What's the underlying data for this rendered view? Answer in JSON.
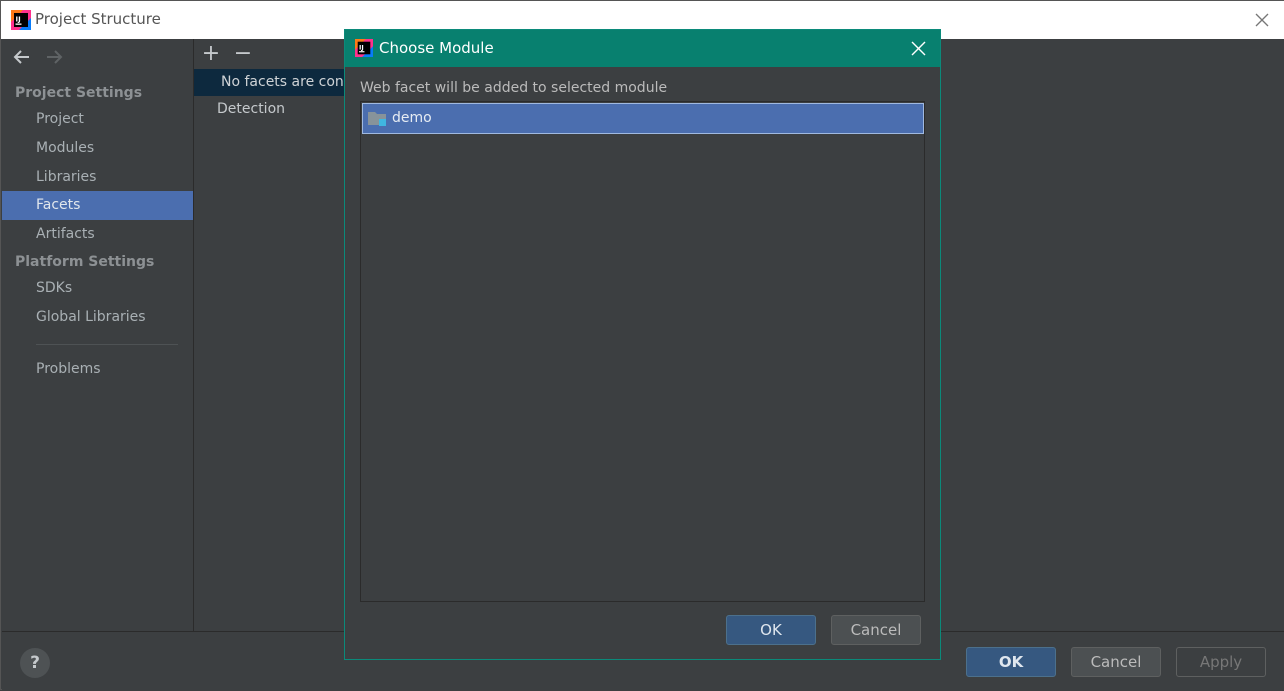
{
  "window": {
    "title": "Project Structure"
  },
  "sidebar": {
    "project_settings_header": "Project Settings",
    "platform_settings_header": "Platform Settings",
    "items": [
      {
        "label": "Project"
      },
      {
        "label": "Modules"
      },
      {
        "label": "Libraries"
      },
      {
        "label": "Facets",
        "selected": true
      },
      {
        "label": "Artifacts"
      }
    ],
    "platform_items": [
      {
        "label": "SDKs"
      },
      {
        "label": "Global Libraries"
      }
    ],
    "problems": "Problems"
  },
  "facets_panel": {
    "add_label": "+",
    "remove_label": "−",
    "empty_text": "No facets are configured",
    "detection": "Detection"
  },
  "bottom": {
    "help_label": "?",
    "ok_label": "OK",
    "cancel_label": "Cancel",
    "apply_label": "Apply"
  },
  "dialog": {
    "title": "Choose Module",
    "description": "Web facet will be added to selected module",
    "modules": [
      {
        "name": "demo",
        "selected": true
      }
    ],
    "ok_label": "OK",
    "cancel_label": "Cancel"
  },
  "colors": {
    "dialog_titlebar": "#08806f",
    "selection": "#4b6eaf",
    "background": "#3c3f41"
  }
}
